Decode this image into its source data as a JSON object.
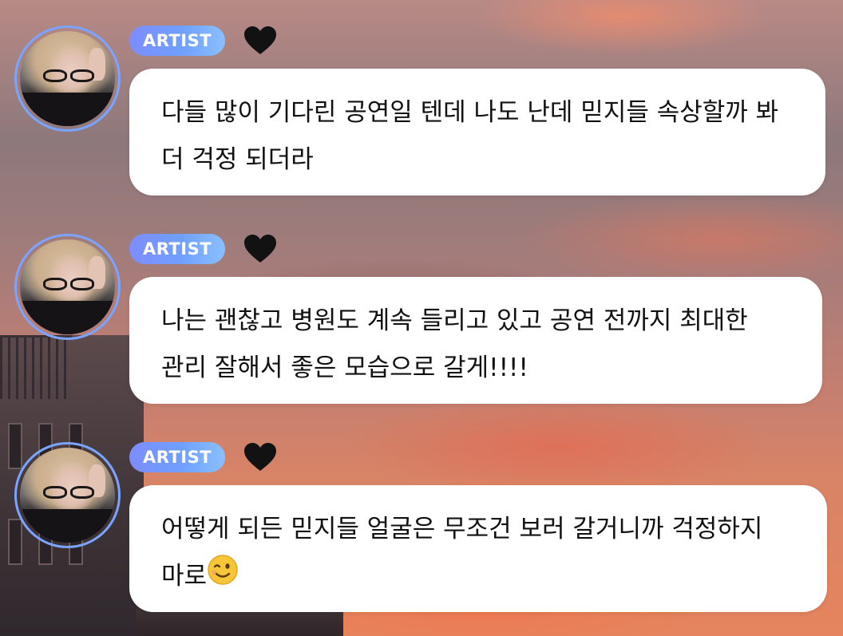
{
  "messages": [
    {
      "badge": "ARTIST",
      "heart": "black-heart",
      "text": "다들 많이 기다린 공연일 텐데 나도 난데 믿지들 속상할까 봐 더 걱정 되더라"
    },
    {
      "badge": "ARTIST",
      "heart": "black-heart",
      "text": "나는 괜찮고 병원도 계속 들리고 있고 공연 전까지 최대한 관리 잘해서 좋은 모습으로 갈게!!!!"
    },
    {
      "badge": "ARTIST",
      "heart": "black-heart",
      "text": "어떻게 되든 믿지들 얼굴은 무조건 보러 갈거니까 걱정하지 마로",
      "emoji": "winking-face"
    }
  ],
  "colors": {
    "badge_gradient_start": "#7d8cff",
    "badge_gradient_end": "#8ac0ff",
    "avatar_ring": "#7aa4ff",
    "bubble_bg": "#ffffff",
    "text": "#111111"
  }
}
